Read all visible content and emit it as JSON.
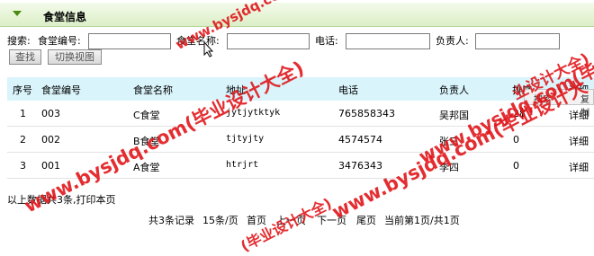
{
  "panel": {
    "title": "食堂信息"
  },
  "search": {
    "label": "搜索:",
    "canteen_no_label": "食堂编号:",
    "canteen_no_value": "",
    "canteen_name_label": "食堂名称:",
    "canteen_name_value": "",
    "phone_label": "电话:",
    "phone_value": "",
    "manager_label": "负责人:",
    "manager_value": "",
    "find_button": "查找",
    "switch_view_button": "切换视图"
  },
  "table": {
    "headers": [
      "序号",
      "食堂编号",
      "食堂名称",
      "地址",
      "电话",
      "负责人",
      "排序",
      "详细"
    ],
    "rows": [
      {
        "index": "1",
        "no": "003",
        "name": "C食堂",
        "address": "jytjytktyk",
        "phone": "765858343",
        "manager": "吴邦国",
        "order": "28",
        "detail": "详细"
      },
      {
        "index": "2",
        "no": "002",
        "name": "B食堂",
        "address": "tjtyjty",
        "phone": "4574574",
        "manager": "张三",
        "order": "0",
        "detail": "详细"
      },
      {
        "index": "3",
        "no": "001",
        "name": "A食堂",
        "address": "htrjrt",
        "phone": "3476343",
        "manager": "李四",
        "order": "0",
        "detail": "详细"
      }
    ]
  },
  "context_popup": {
    "search": "搜索",
    "copy": "复制"
  },
  "footer": {
    "summary": "以上数据共3条,打印本页"
  },
  "pager": {
    "total": "共3条记录",
    "per_page": "15条/页",
    "first": "首页",
    "prev": "上一页",
    "next": "下一页",
    "last": "尾页",
    "current": "当前第1页/共1页"
  },
  "watermarks": [
    "www.bysjdq.com(毕业设计大全)",
    "www.bysjdq.com(毕业设计大全)",
    "www.bysjdq.com(毕业设计大",
    "www.bysjdq.com(毕业设计大全)",
    "(毕业设计大全)",
    "业设计大全)"
  ],
  "colors": {
    "title_bg": "#dcefc7",
    "header_bg": "#d9f4fb",
    "watermark": "#e0171b",
    "arrow": "#4a8b10"
  }
}
